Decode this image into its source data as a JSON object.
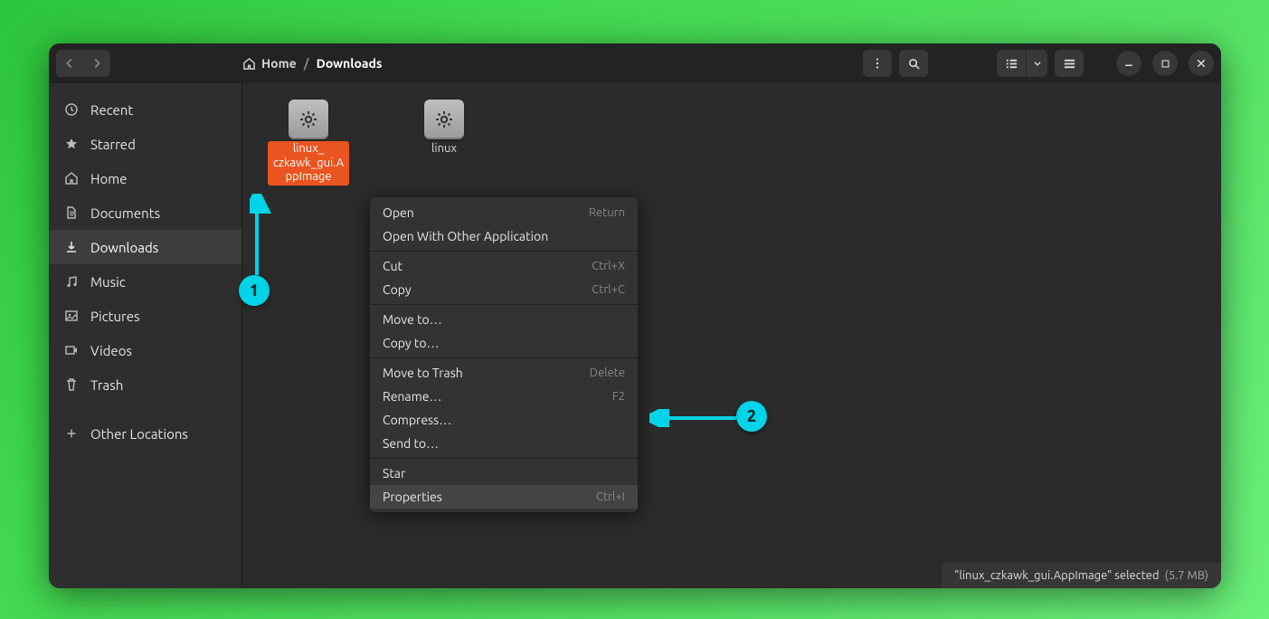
{
  "breadcrumb": {
    "home": "Home",
    "current": "Downloads"
  },
  "sidebar": {
    "items": [
      {
        "label": "Recent",
        "icon": "clock"
      },
      {
        "label": "Starred",
        "icon": "star"
      },
      {
        "label": "Home",
        "icon": "home"
      },
      {
        "label": "Documents",
        "icon": "doc"
      },
      {
        "label": "Downloads",
        "icon": "download",
        "active": true
      },
      {
        "label": "Music",
        "icon": "music"
      },
      {
        "label": "Pictures",
        "icon": "picture"
      },
      {
        "label": "Videos",
        "icon": "video"
      },
      {
        "label": "Trash",
        "icon": "trash"
      }
    ],
    "other": "Other Locations"
  },
  "files": [
    {
      "name": "linux_czkawk_gui.AppImage",
      "display": "linux_\nczkawk_gui.AppImage",
      "selected": true
    },
    {
      "name": "linux",
      "display": "linux",
      "selected": false
    }
  ],
  "context_menu": [
    {
      "label": "Open",
      "accel": "Return"
    },
    {
      "label": "Open With Other Application",
      "accel": ""
    },
    {
      "sep": true
    },
    {
      "label": "Cut",
      "accel": "Ctrl+X"
    },
    {
      "label": "Copy",
      "accel": "Ctrl+C"
    },
    {
      "sep": true
    },
    {
      "label": "Move to…",
      "accel": ""
    },
    {
      "label": "Copy to…",
      "accel": ""
    },
    {
      "sep": true
    },
    {
      "label": "Move to Trash",
      "accel": "Delete"
    },
    {
      "label": "Rename…",
      "accel": "F2"
    },
    {
      "label": "Compress…",
      "accel": ""
    },
    {
      "label": "Send to…",
      "accel": ""
    },
    {
      "sep": true
    },
    {
      "label": "Star",
      "accel": ""
    },
    {
      "label": "Properties",
      "accel": "Ctrl+I",
      "hover": true
    }
  ],
  "status": {
    "text": "\"linux_czkawk_gui.AppImage\" selected",
    "size": "(5.7 MB)"
  },
  "annotations": {
    "one": "1",
    "two": "2"
  }
}
